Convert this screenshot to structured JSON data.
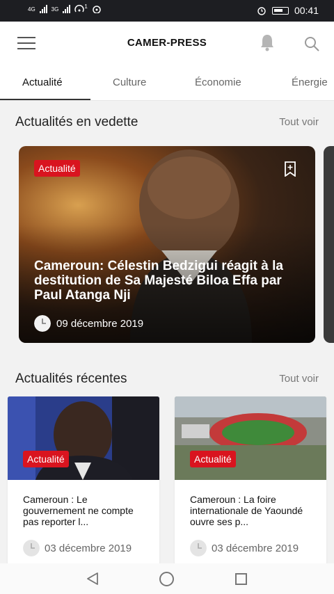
{
  "status_bar": {
    "network1": "4G",
    "network2": "3G",
    "hotspot_count": "1",
    "time": "00:41"
  },
  "app_bar": {
    "title": "CAMER-PRESS",
    "icons": [
      "menu-icon",
      "bell-icon",
      "search-icon"
    ]
  },
  "tabs": [
    {
      "label": "Actualité",
      "active": true
    },
    {
      "label": "Culture",
      "active": false
    },
    {
      "label": "Économie",
      "active": false
    },
    {
      "label": "Énergie",
      "active": false
    }
  ],
  "featured_section": {
    "title": "Actualités en vedette",
    "see_all": "Tout voir",
    "article": {
      "category": "Actualité",
      "title": "Cameroun: Célestin Bedzigui réagit à la destitution de Sa Majesté Biloa Effa par Paul Atanga Nji",
      "date": "09 décembre 2019"
    }
  },
  "recent_section": {
    "title": "Actualités récentes",
    "see_all": "Tout voir",
    "articles": [
      {
        "category": "Actualité",
        "title": "Cameroun : Le gouvernement ne compte pas reporter l...",
        "date": "03 décembre 2019"
      },
      {
        "category": "Actualité",
        "title": "Cameroun : La foire internationale de Yaoundé ouvre ses p...",
        "date": "03 décembre 2019"
      }
    ]
  },
  "colors": {
    "accent_badge": "#d9141f",
    "status_bar": "#1d1e22"
  }
}
